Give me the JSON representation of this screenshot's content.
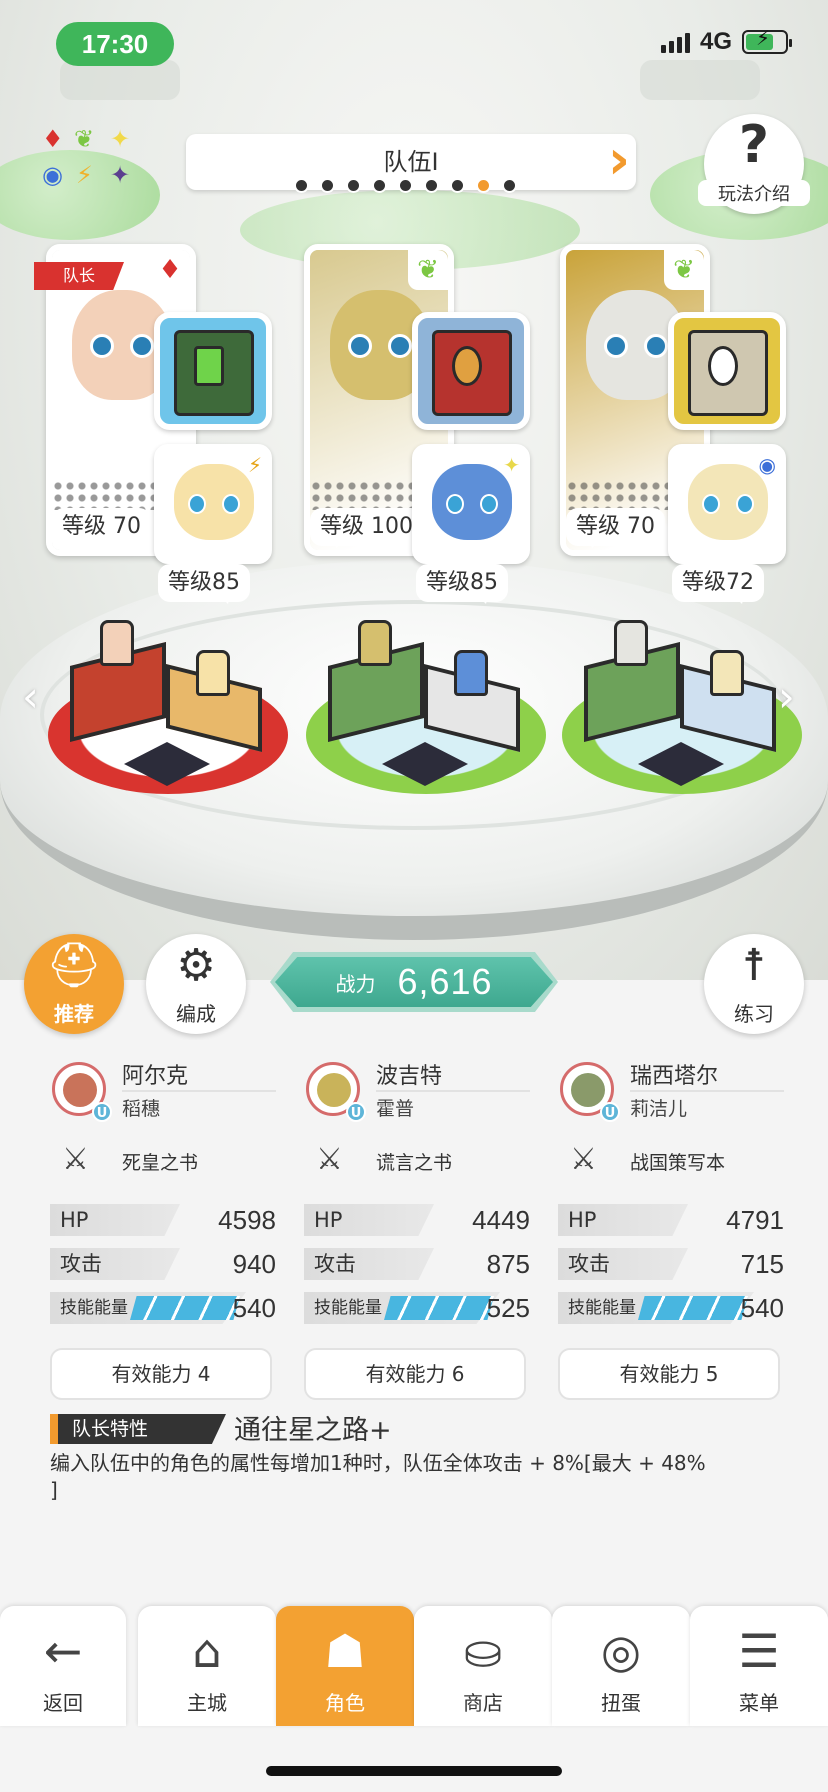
{
  "status_bar": {
    "time": "17:30",
    "network": "4G"
  },
  "team": {
    "title": "队伍Ⅰ",
    "page_count": 9,
    "active_index": 7
  },
  "help": {
    "label": "玩法介绍"
  },
  "leader_tag": "队长",
  "characters": [
    {
      "level": "等级 70",
      "sub_level": "等级85",
      "attr": "fire",
      "attr_icon": "♦",
      "attr_color": "#d9322f",
      "bg": "#ffffff",
      "face_color": "#f3d1b9",
      "book_color": "#3e6a3a",
      "book_bg": "#6fc5ea",
      "sub_face": "#f7e2a8",
      "sub_badge": "⚡",
      "sub_badge_color": "#e6a417",
      "ped_color": "#d9342f",
      "ped_ring": "#ffffff",
      "block_a": "#c4422e",
      "block_b": "#e8b86a"
    },
    {
      "level": "等级 100",
      "sub_level": "等级85",
      "attr": "wind",
      "attr_icon": "❦",
      "attr_color": "#7cc743",
      "bg": "#d8c98f",
      "face_color": "#d5bf6e",
      "book_color": "#b6332e",
      "book_bg": "#8fb4d8",
      "sub_face": "#5d8fd8",
      "sub_badge": "✦",
      "sub_badge_color": "#e8d84a",
      "ped_color": "#8ed04a",
      "ped_ring": "#d7f0f6",
      "block_a": "#6da25a",
      "block_b": "#e6e6e6"
    },
    {
      "level": "等级 70",
      "sub_level": "等级72",
      "attr": "wind",
      "attr_icon": "❦",
      "attr_color": "#7cc743",
      "bg": "#c9a33a",
      "face_color": "#e5e5e0",
      "book_color": "#cfc7b0",
      "book_bg": "#e3c642",
      "sub_face": "#f3e6b8",
      "sub_badge": "◉",
      "sub_badge_color": "#3c6fd8",
      "ped_color": "#8ed04a",
      "ped_ring": "#d7f0f6",
      "block_a": "#6da25a",
      "block_b": "#cfe0f0"
    }
  ],
  "actions": {
    "recommend": "推荐",
    "formation": "编成",
    "practice": "练习"
  },
  "power": {
    "label": "战力",
    "value": "6,616"
  },
  "members": [
    {
      "name": "阿尔克",
      "sub": "稻穗",
      "weapon": "死皇之书",
      "hp": "4598",
      "atk": "940",
      "energy": "540",
      "effective": "有效能力 4",
      "avatar_color": "#c9735a"
    },
    {
      "name": "波吉特",
      "sub": "霍普",
      "weapon": "谎言之书",
      "hp": "4449",
      "atk": "875",
      "energy": "525",
      "effective": "有效能力 6",
      "avatar_color": "#c9b35a"
    },
    {
      "name": "瑞西塔尔",
      "sub": "莉洁儿",
      "weapon": "战国策写本",
      "hp": "4791",
      "atk": "715",
      "energy": "540",
      "effective": "有效能力 5",
      "avatar_color": "#8a9a6a"
    }
  ],
  "labels": {
    "hp": "HP",
    "atk": "攻击",
    "energy": "技能能量"
  },
  "leader_trait": {
    "tag": "队长特性",
    "title": "通往星之路+",
    "description": "编入队伍中的角色的属性每增加1种时，队伍全体攻击 + 8%[最大 + 48% ]"
  },
  "nav": [
    {
      "label": "返回",
      "icon": "arrow-left-icon",
      "glyph": "←"
    },
    {
      "label": "主城",
      "icon": "castle-icon",
      "glyph": "⌂"
    },
    {
      "label": "角色",
      "icon": "character-icon",
      "glyph": "☗"
    },
    {
      "label": "商店",
      "icon": "shop-icon",
      "glyph": "⛀"
    },
    {
      "label": "扭蛋",
      "icon": "gacha-icon",
      "glyph": "◎"
    },
    {
      "label": "菜单",
      "icon": "menu-icon",
      "glyph": "☰"
    }
  ],
  "nav_active": 2
}
